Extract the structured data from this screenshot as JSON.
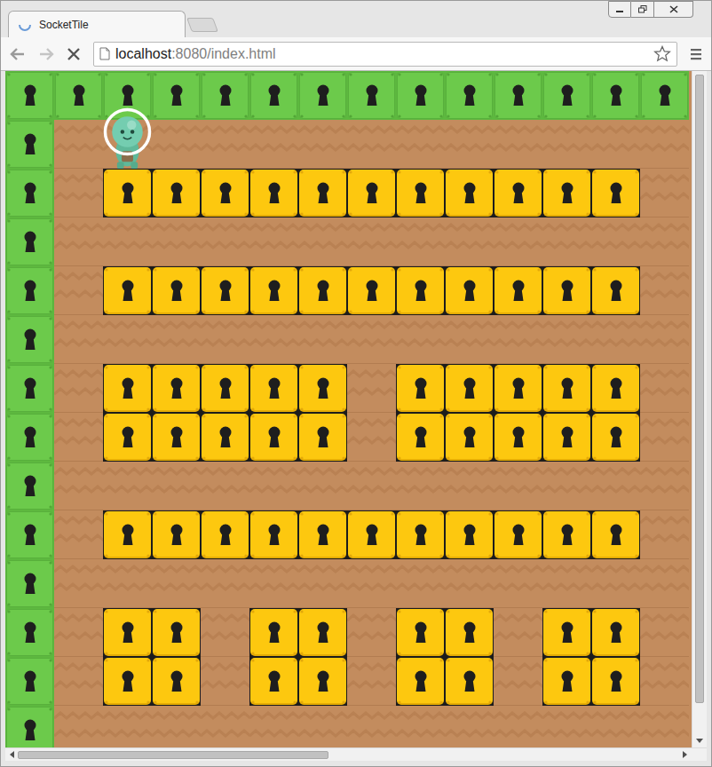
{
  "window": {
    "title": "SocketTile"
  },
  "tabs": [
    {
      "label": "SocketTile",
      "selected": true,
      "loading": true
    }
  ],
  "address": {
    "host": "localhost",
    "path": ":8080/index.html"
  },
  "map": {
    "rows": [
      [
        "wall",
        "wall",
        "wall",
        "wall",
        "wall",
        "wall",
        "wall",
        "wall",
        "wall",
        "wall",
        "wall",
        "wall",
        "wall",
        "wall"
      ],
      [
        "wall",
        "floor",
        "floor",
        "floor",
        "floor",
        "floor",
        "floor",
        "floor",
        "floor",
        "floor",
        "floor",
        "floor",
        "floor",
        "floor"
      ],
      [
        "wall",
        "floor",
        "block",
        "block",
        "block",
        "block",
        "block",
        "block",
        "block",
        "block",
        "block",
        "block",
        "block",
        "floor"
      ],
      [
        "wall",
        "floor",
        "floor",
        "floor",
        "floor",
        "floor",
        "floor",
        "floor",
        "floor",
        "floor",
        "floor",
        "floor",
        "floor",
        "floor"
      ],
      [
        "wall",
        "floor",
        "block",
        "block",
        "block",
        "block",
        "block",
        "block",
        "block",
        "block",
        "block",
        "block",
        "block",
        "floor"
      ],
      [
        "wall",
        "floor",
        "floor",
        "floor",
        "floor",
        "floor",
        "floor",
        "floor",
        "floor",
        "floor",
        "floor",
        "floor",
        "floor",
        "floor"
      ],
      [
        "wall",
        "floor",
        "block",
        "block",
        "block",
        "block",
        "block",
        "floor",
        "block",
        "block",
        "block",
        "block",
        "block",
        "floor"
      ],
      [
        "wall",
        "floor",
        "block",
        "block",
        "block",
        "block",
        "block",
        "floor",
        "block",
        "block",
        "block",
        "block",
        "block",
        "floor"
      ],
      [
        "wall",
        "floor",
        "floor",
        "floor",
        "floor",
        "floor",
        "floor",
        "floor",
        "floor",
        "floor",
        "floor",
        "floor",
        "floor",
        "floor"
      ],
      [
        "wall",
        "floor",
        "block",
        "block",
        "block",
        "block",
        "block",
        "block",
        "block",
        "block",
        "block",
        "block",
        "block",
        "floor"
      ],
      [
        "wall",
        "floor",
        "floor",
        "floor",
        "floor",
        "floor",
        "floor",
        "floor",
        "floor",
        "floor",
        "floor",
        "floor",
        "floor",
        "floor"
      ],
      [
        "wall",
        "floor",
        "block",
        "block",
        "floor",
        "block",
        "block",
        "floor",
        "block",
        "block",
        "floor",
        "block",
        "block",
        "floor"
      ],
      [
        "wall",
        "floor",
        "block",
        "block",
        "floor",
        "block",
        "block",
        "floor",
        "block",
        "block",
        "floor",
        "block",
        "block",
        "floor"
      ],
      [
        "wall",
        "floor",
        "floor",
        "floor",
        "floor",
        "floor",
        "floor",
        "floor",
        "floor",
        "floor",
        "floor",
        "floor",
        "floor",
        "floor"
      ]
    ],
    "player": {
      "row": 1,
      "col": 2,
      "selected": true
    }
  },
  "scrollbars": {
    "horizontal": {
      "level": 0.47
    },
    "vertical": {
      "level": 0.97
    }
  }
}
